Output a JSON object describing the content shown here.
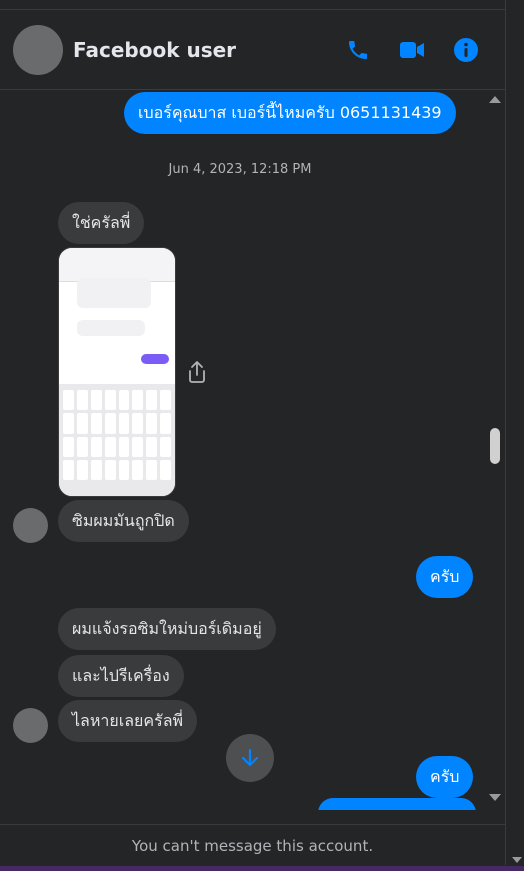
{
  "header": {
    "name": "Facebook user",
    "icons": [
      "phone-icon",
      "video-icon",
      "info-icon"
    ],
    "accent": "#0084ff"
  },
  "timestamp": "Jun 4, 2023, 12:18 PM",
  "messages": [
    {
      "side": "out",
      "text": "เบอร์คุณบาส เบอร์นี้ไหมครับ 0651131439"
    },
    {
      "side": "in",
      "text": "ใช่ครัลพี่"
    },
    {
      "side": "in",
      "type": "image",
      "text": ""
    },
    {
      "side": "in",
      "text": "ซิมผมมันถูกปิด"
    },
    {
      "side": "out",
      "text": "ครับ"
    },
    {
      "side": "in",
      "text": "ผมแจ้งรอซิมใหม่บอร์เดิมอยู่"
    },
    {
      "side": "in",
      "text": "และไปรีเครื่อง"
    },
    {
      "side": "in",
      "text": "ไลหายเลยครัลพี่"
    },
    {
      "side": "out",
      "text": "ครับ"
    }
  ],
  "footer": {
    "notice": "You can't message this account."
  }
}
